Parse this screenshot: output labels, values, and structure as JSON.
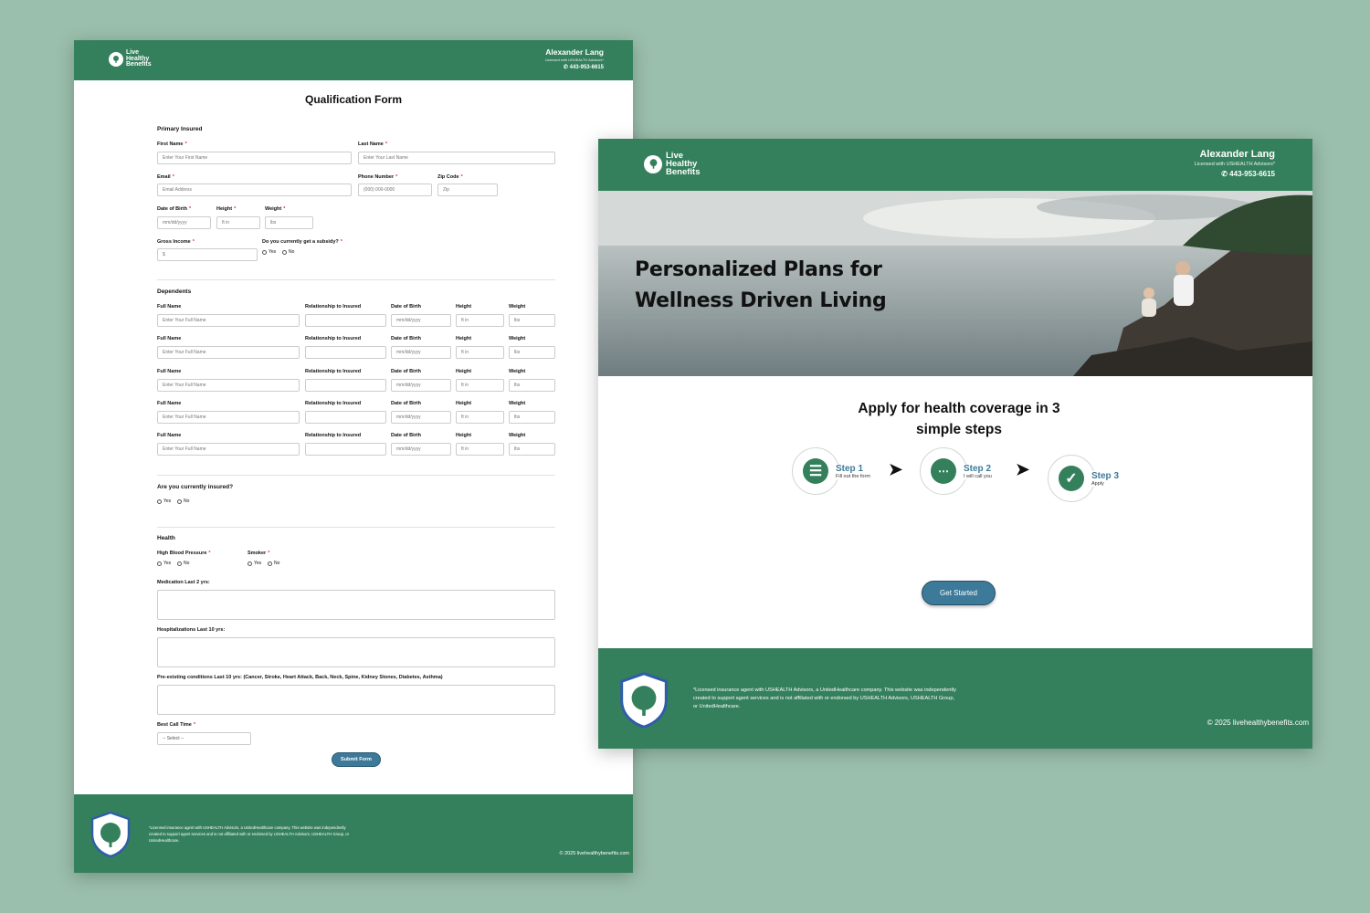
{
  "brand": {
    "logo_line1": "Live",
    "logo_line2": "Healthy",
    "logo_line3": "Benefits"
  },
  "agent": {
    "name": "Alexander Lang",
    "license": "Licensed with USHEALTH Advisors*",
    "phone": "443-953-6615"
  },
  "form": {
    "title": "Qualification Form",
    "primary": {
      "section": "Primary Insured",
      "first_name_label": "First Name",
      "first_name_ph": "Enter Your First Name",
      "last_name_label": "Last Name",
      "last_name_ph": "Enter Your Last Name",
      "email_label": "Email",
      "email_ph": "Email Address",
      "phone_label": "Phone Number",
      "phone_ph": "(000) 000-0000",
      "zip_label": "Zip Code",
      "zip_ph": "Zip",
      "dob_label": "Date of Birth",
      "dob_ph": "mm/dd/yyyy",
      "height_label": "Height",
      "height_ph": "ft in",
      "weight_label": "Weight",
      "weight_ph": "lbs",
      "income_label": "Gross Income",
      "income_ph": "$",
      "subsidy_label": "Do you currently get a subsidy?",
      "yes": "Yes",
      "no": "No"
    },
    "dependents": {
      "section": "Dependents",
      "full_name_label": "Full Name",
      "full_name_ph": "Enter Your Full Name",
      "relationship_label": "Relationship to Insured",
      "dob_label": "Date of Birth",
      "dob_ph": "mm/dd/yyyy",
      "height_label": "Height",
      "height_ph": "ft in",
      "weight_label": "Weight",
      "weight_ph": "lbs"
    },
    "insured": {
      "question": "Are you currently insured?",
      "yes": "Yes",
      "no": "No"
    },
    "health": {
      "section": "Health",
      "bp_label": "High Blood Pressure",
      "smoker_label": "Smoker",
      "yes": "Yes",
      "no": "No",
      "medication_label": "Medication Last 2 yrs:",
      "hosp_label": "Hospitalizations Last 10 yrs:",
      "preexisting_label": "Pre-existing conditions Last 10 yrs: (Cancer, Stroke, Heart Attack, Back, Neck, Spine, Kidney Stones, Diabetes, Asthma)",
      "call_time_label": "Best Call Time",
      "call_time_value": "-- Select --"
    },
    "submit_label": "Submit Form"
  },
  "landing": {
    "hero_line1": "Personalized Plans for",
    "hero_line2": "Wellness Driven Living",
    "steps_title_line1": "Apply for health coverage in 3",
    "steps_title_line2": "simple steps",
    "steps": [
      {
        "title": "Step 1",
        "sub": "Fill out the form",
        "icon": "checklist-icon"
      },
      {
        "title": "Step 2",
        "sub": "I will call you",
        "icon": "chat-bubbles-icon"
      },
      {
        "title": "Step 3",
        "sub": "Apply",
        "icon": "checkmark-icon"
      }
    ],
    "cta": "Get Started"
  },
  "footer": {
    "disclaimer": "*Licensed insurance agent with USHEALTH Advisors, a UnitedHealthcare company. This website was independently created to support agent services and is not affiliated with or endorsed by USHEALTH Advisors, USHEALTH Group, or UnitedHealthcare.",
    "copyright": "© 2025 livehealthybenefits.com"
  },
  "colors": {
    "brand_green": "#35805c",
    "button_blue": "#3d7a9a",
    "background": "#9bbfad"
  }
}
